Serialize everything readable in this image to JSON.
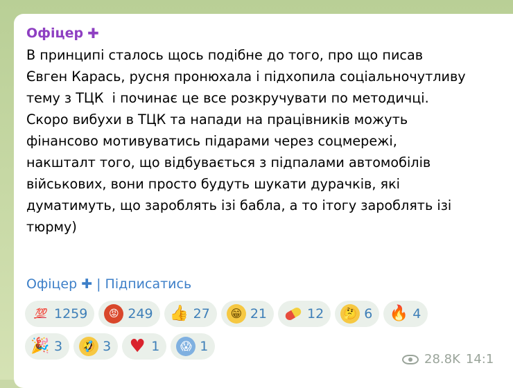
{
  "post": {
    "author": "Офіцер",
    "author_badge_icon": "plus-icon",
    "text": "В принципі сталось щось подібне до того, про що писав\nЄвген Карась, русня пронюхала і підхопила соціальночутливу\nтему з ТЦК  і починає це все розкручувати по методичці.\nСкоро вибухи в ТЦК та напади на працівників можуть\nфінансово мотивуватись підарами через соцмережі,\nнакшталт того, що відбувається з підпалами автомобілів\nвійськових, вони просто будуть шукати дурачків, які\nдуматимуть, що зароблять ізі бабла, а то ітогу зароблять ізі\nтюрму)",
    "footer": {
      "channel_link": "Офіцер",
      "separator": "|",
      "subscribe_link": "Підписатись"
    },
    "reactions": [
      {
        "emoji": "hundred-points-icon",
        "count": "1259"
      },
      {
        "emoji": "angry-face-icon",
        "count": "249"
      },
      {
        "emoji": "thumbs-up-icon",
        "count": "27"
      },
      {
        "emoji": "grinning-face-icon",
        "count": "21"
      },
      {
        "emoji": "pill-icon",
        "count": "12"
      },
      {
        "emoji": "thinking-face-icon",
        "count": "6"
      },
      {
        "emoji": "fire-icon",
        "count": "4"
      },
      {
        "emoji": "party-popper-icon",
        "count": "3"
      },
      {
        "emoji": "rofl-face-icon",
        "count": "3"
      },
      {
        "emoji": "red-heart-icon",
        "count": "1"
      },
      {
        "emoji": "screaming-face-icon",
        "count": "1"
      }
    ],
    "views": "28.8K",
    "time": "14:1"
  }
}
